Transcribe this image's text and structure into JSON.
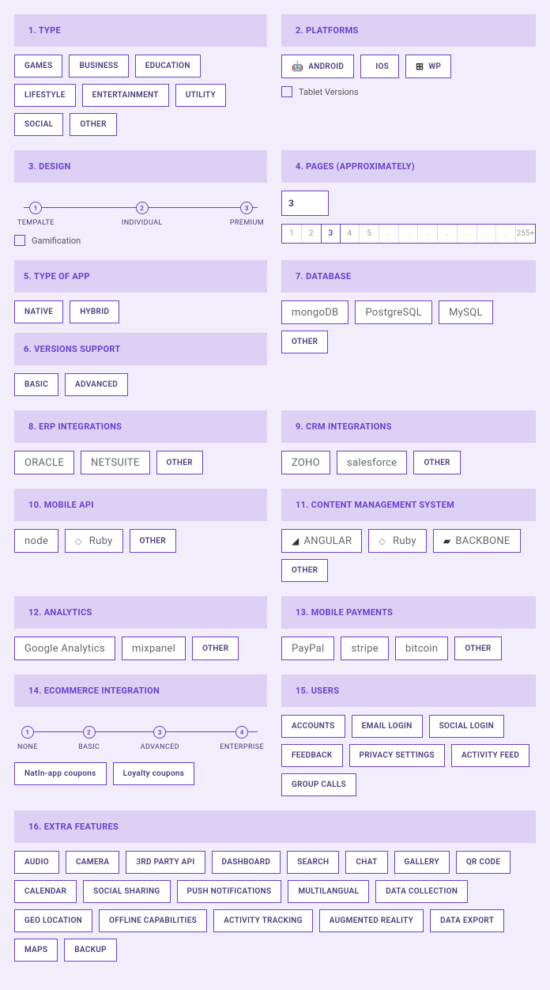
{
  "s1": {
    "title": "1. TYPE",
    "opts": [
      "GAMES",
      "BUSINESS",
      "EDUCATION",
      "LIFESTYLE",
      "ENTERTAINMENT",
      "UTILITY",
      "SOCIAL",
      "OTHER"
    ]
  },
  "s2": {
    "title": "2. PLATFORMS",
    "opts": [
      "ANDROID",
      "IOS",
      "WP"
    ],
    "cb": "Tablet Versions"
  },
  "s3": {
    "title": "3. DESIGN",
    "nodes": [
      "TEMPALTE",
      "INDIVIDUAL",
      "PREMIUM"
    ],
    "cb": "Gamification"
  },
  "s4": {
    "title": "4. PAGES (APPROXIMATELY)",
    "val": "3",
    "pgs": [
      "1",
      "2",
      "3",
      "4",
      "5",
      ".",
      ".",
      ".",
      ".",
      ".",
      ".",
      ".",
      "255+"
    ]
  },
  "s5": {
    "title": "5. TYPE OF APP",
    "opts": [
      "NATIVE",
      "HYBRID"
    ]
  },
  "s6": {
    "title": "6. VERSIONS SUPPORT",
    "opts": [
      "BASIC",
      "ADVANCED"
    ]
  },
  "s7": {
    "title": "7. DATABASE",
    "opts": [
      "mongoDB",
      "PostgreSQL",
      "MySQL"
    ],
    "other": "OTHER"
  },
  "s8": {
    "title": "8. ERP INTEGRATIONS",
    "opts": [
      "ORACLE",
      "NETSUITE"
    ],
    "other": "OTHER"
  },
  "s9": {
    "title": "9. CRM INTEGRATIONS",
    "opts": [
      "ZOHO",
      "salesforce"
    ],
    "other": "OTHER"
  },
  "s10": {
    "title": "10. MOBILE API",
    "opts": [
      "node",
      "Ruby"
    ],
    "other": "OTHER"
  },
  "s11": {
    "title": "11. CONTENT MANAGEMENT SYSTEM",
    "opts": [
      "ANGULAR",
      "Ruby",
      "BACKBONE"
    ],
    "other": "OTHER"
  },
  "s12": {
    "title": "12. ANALYTICS",
    "opts": [
      "Google Analytics",
      "mixpanel"
    ],
    "other": "OTHER"
  },
  "s13": {
    "title": "13. MOBILE PAYMENTS",
    "opts": [
      "PayPal",
      "stripe",
      "bitcoin"
    ],
    "other": "OTHER"
  },
  "s14": {
    "title": "14. ECOMMERCE INTEGRATION",
    "nodes": [
      "NONE",
      "BASIC",
      "ADVANCED",
      "ENTERPRISE"
    ],
    "opts": [
      "NatIn-app coupons",
      "Loyalty coupons"
    ]
  },
  "s15": {
    "title": "15. USERS",
    "opts": [
      "ACCOUNTS",
      "EMAIL LOGIN",
      "SOCIAL LOGIN",
      "FEEDBACK",
      "PRIVACY SETTINGS",
      "ACTIVITY FEED",
      "GROUP CALLS"
    ]
  },
  "s16": {
    "title": "16. EXTRA FEATURES",
    "opts": [
      "AUDIO",
      "CAMERA",
      "3RD PARTY API",
      "DASHBOARD",
      "SEARCH",
      "CHAT",
      "GALLERY",
      "QR CODE",
      "CALENDAR",
      "SOCIAL SHARING",
      "PUSH NOTIFICATIONS",
      "MULTILANGUAL",
      "DATA COLLECTION",
      "GEO LOCATION",
      "OFFLINE CAPABILITIES",
      "ACTIVITY TRACKING",
      "AUGMENTED REALITY",
      "DATA EXPORT",
      "MAPS",
      "BACKUP"
    ]
  }
}
